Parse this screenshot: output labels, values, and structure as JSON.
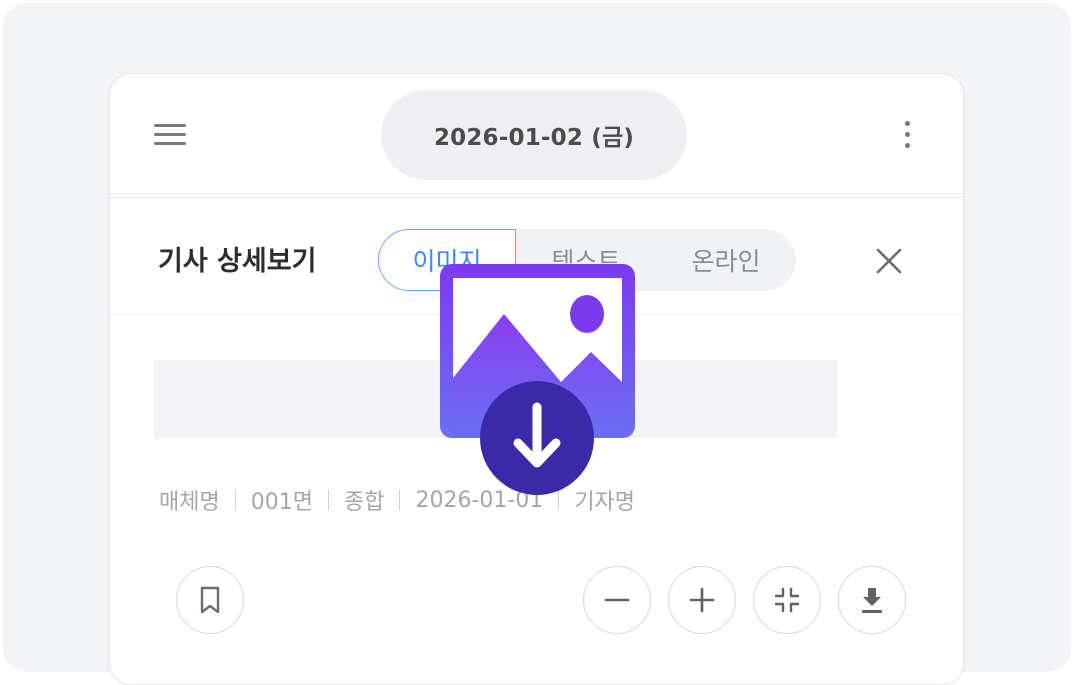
{
  "header": {
    "date": "2026-01-02 (금)",
    "menu_icon": "hamburger-menu-icon",
    "more_icon": "more-vertical-icon"
  },
  "panel": {
    "title": "기사 상세보기",
    "tabs": [
      {
        "label": "이미지",
        "active": true
      },
      {
        "label": "텍스트",
        "active": false
      },
      {
        "label": "온라인",
        "active": false
      }
    ],
    "close_icon": "close-icon"
  },
  "article": {
    "meta": [
      "매체명",
      "001면",
      "종합",
      "2026-01-01",
      "기자명"
    ]
  },
  "actions": {
    "bookmark_icon": "bookmark-icon",
    "zoom_out_icon": "minus-icon",
    "zoom_in_icon": "plus-icon",
    "fit_icon": "fit-screen-icon",
    "download_icon": "download-icon"
  },
  "overlay": {
    "icon": "image-download-icon",
    "colors": {
      "gradient_top": "#7c3aed",
      "gradient_bottom": "#6b6ff2",
      "badge": "#3b2aa8"
    }
  },
  "colors": {
    "accent": "#3f87ff",
    "backdrop": "#f3f4f8"
  }
}
